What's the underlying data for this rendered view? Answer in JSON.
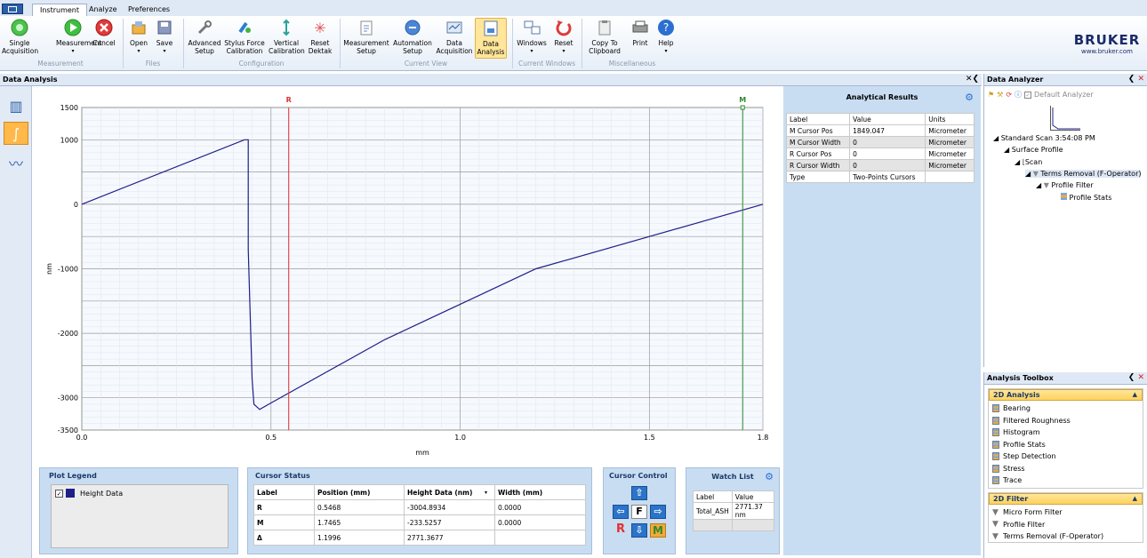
{
  "tabs": [
    "Instrument",
    "Analyze",
    "Preferences"
  ],
  "ribbon": {
    "buttons": [
      {
        "label": "Single\nAcquisition",
        "icon": "green-circle-icon"
      },
      {
        "label": "Measurement",
        "icon": "play-icon"
      },
      {
        "label": "Cancel",
        "icon": "cancel-icon"
      },
      {
        "label": "Open",
        "icon": "open-icon"
      },
      {
        "label": "Save",
        "icon": "save-icon"
      },
      {
        "label": "Advanced\nSetup",
        "icon": "tools-icon"
      },
      {
        "label": "Stylus Force\nCalibration",
        "icon": "stylus-icon"
      },
      {
        "label": "Vertical\nCalibration",
        "icon": "vertical-icon"
      },
      {
        "label": "Reset\nDektak",
        "icon": "reset-icon"
      },
      {
        "label": "Measurement\nSetup",
        "icon": "notepad-icon"
      },
      {
        "label": "Automation\nSetup",
        "icon": "automation-icon"
      },
      {
        "label": "Data\nAcquisition",
        "icon": "acq-icon"
      },
      {
        "label": "Data\nAnalysis",
        "icon": "analysis-icon"
      },
      {
        "label": "Windows",
        "icon": "windows-icon"
      },
      {
        "label": "Reset",
        "icon": "reset-windows-icon"
      },
      {
        "label": "Copy To\nClipboard",
        "icon": "clipboard-icon"
      },
      {
        "label": "Print",
        "icon": "print-icon"
      },
      {
        "label": "Help",
        "icon": "help-icon"
      }
    ],
    "groups": [
      "Measurement",
      "Files",
      "Configuration",
      "Current View",
      "Current Windows",
      "Miscellaneous"
    ]
  },
  "brand": {
    "name": "BRUKER",
    "url": "www.bruker.com"
  },
  "data_analysis": {
    "title": "Data Analysis"
  },
  "chart_data": {
    "type": "line",
    "xlabel": "mm",
    "ylabel": "nm",
    "xlim": [
      0,
      1.8
    ],
    "ylim": [
      -3500,
      1500
    ],
    "xticks": [
      "0.0",
      "0.5",
      "1.0",
      "1.5",
      "1.8"
    ],
    "yticks": [
      "1500",
      "1000",
      "0",
      "-1000",
      "-2000",
      "-3000",
      "-3500"
    ],
    "series": [
      {
        "x": [
          0,
          0.43,
          0.44,
          0.44,
          0.45,
          0.455,
          0.47,
          0.5,
          0.8,
          1.2,
          1.8
        ],
        "y": [
          0,
          1000,
          1000,
          -700,
          -2700,
          -3100,
          -3180,
          -3080,
          -2100,
          -1000,
          0
        ]
      }
    ],
    "cursors": [
      {
        "label": "R",
        "x": 0.5468,
        "color": "#e03030"
      },
      {
        "label": "M",
        "x": 1.7465,
        "color": "#2e8b2e"
      }
    ],
    "color": "#1f1f8a"
  },
  "analytical": {
    "title": "Analytical Results",
    "headers": [
      "Label",
      "Value",
      "Units"
    ],
    "rows": [
      [
        "M Cursor Pos",
        "1849.047",
        "Micrometer"
      ],
      [
        "M Cursor Width",
        "0",
        "Micrometer"
      ],
      [
        "R Cursor Pos",
        "0",
        "Micrometer"
      ],
      [
        "R Cursor Width",
        "0",
        "Micrometer"
      ],
      [
        "Type",
        "Two-Points Cursors",
        ""
      ]
    ]
  },
  "plot_legend": {
    "title": "Plot Legend",
    "item": "Height Data"
  },
  "cursor_status": {
    "title": "Cursor Status",
    "headers": [
      "Label",
      "Position (mm)",
      "Height Data (nm)",
      "Width (mm)"
    ],
    "rows": [
      [
        "R",
        "0.5468",
        "-3004.8934",
        "0.0000"
      ],
      [
        "M",
        "1.7465",
        "-233.5257",
        "0.0000"
      ],
      [
        "Δ",
        "1.1996",
        "2771.3677",
        ""
      ]
    ]
  },
  "cursor_control": {
    "title": "Cursor Control",
    "f": "F",
    "r": "R",
    "m": "M"
  },
  "watch_list": {
    "title": "Watch List",
    "headers": [
      "Label",
      "Value"
    ],
    "rows": [
      [
        "Total_ASH",
        "2771.37 nm"
      ]
    ]
  },
  "data_analyzer": {
    "title": "Data Analyzer",
    "default": "Default Analyzer",
    "tree": [
      "Standard Scan 3:54:08 PM",
      "Surface Profile",
      "Scan",
      "Terms Removal (F-Operator)",
      "Profile Filter",
      "Profile Stats"
    ]
  },
  "toolbox": {
    "title": "Analysis Toolbox",
    "sec1": "2D Analysis",
    "items1": [
      "Bearing",
      "Filtered Roughness",
      "Histogram",
      "Profile Stats",
      "Step Detection",
      "Stress",
      "Trace"
    ],
    "sec2": "2D Filter",
    "items2": [
      "Micro Form Filter",
      "Profile Filter",
      "Terms Removal (F-Operator)"
    ]
  }
}
